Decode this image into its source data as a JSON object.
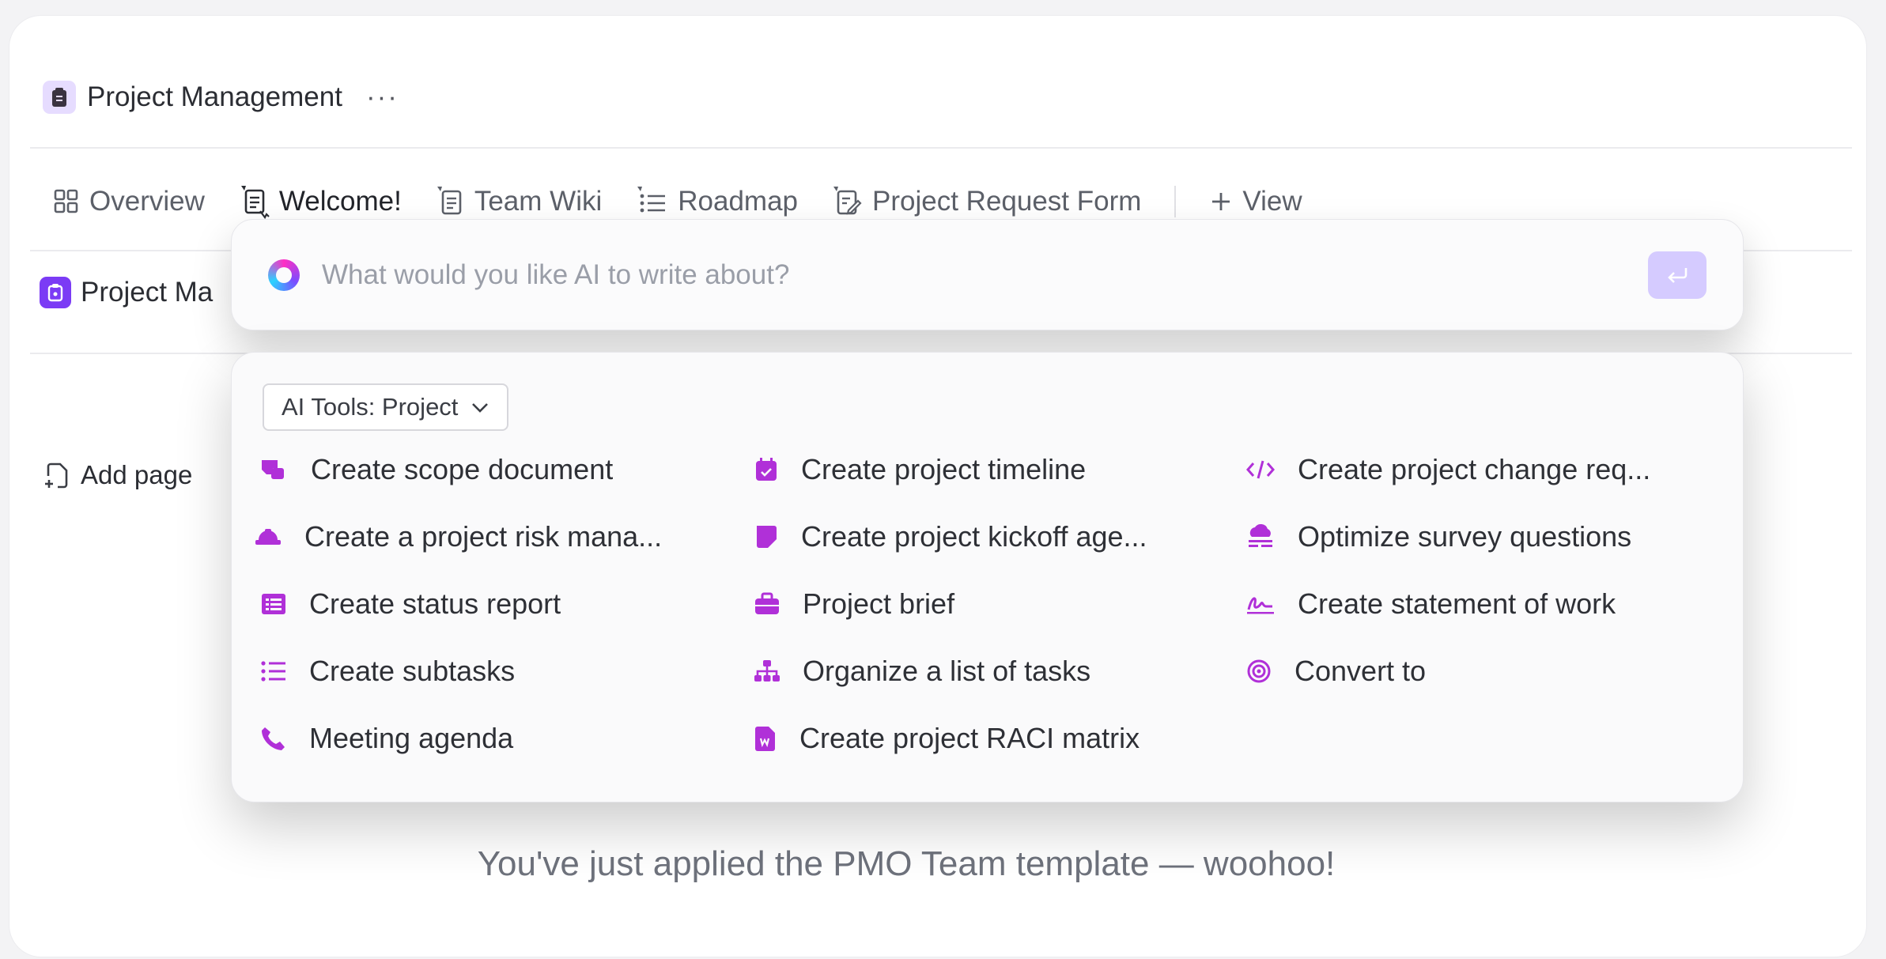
{
  "header": {
    "title": "Project Management",
    "more": "···"
  },
  "tabs": [
    {
      "label": "Overview"
    },
    {
      "label": "Welcome!"
    },
    {
      "label": "Team Wiki"
    },
    {
      "label": "Roadmap"
    },
    {
      "label": "Project Request Form"
    },
    {
      "label": "View"
    }
  ],
  "subheader": {
    "title": "Project Ma"
  },
  "sidebar": {
    "add_page": "Add page"
  },
  "content": {
    "welcome_text": "You've just applied the PMO Team template — woohoo!"
  },
  "ai": {
    "placeholder": "What would you like AI to write about?",
    "tools_label": "AI Tools: Project",
    "accent": "#b030d8",
    "items": [
      {
        "label": "Create scope document",
        "icon": "document-stamp-icon"
      },
      {
        "label": "Create project timeline",
        "icon": "calendar-icon"
      },
      {
        "label": "Create project change req...",
        "icon": "code-icon"
      },
      {
        "label": "Create a project risk mana...",
        "icon": "hardhat-icon"
      },
      {
        "label": "Create project kickoff age...",
        "icon": "note-icon"
      },
      {
        "label": "Optimize survey questions",
        "icon": "cloud-list-icon"
      },
      {
        "label": "Create status report",
        "icon": "list-box-icon"
      },
      {
        "label": "Project brief",
        "icon": "briefcase-icon"
      },
      {
        "label": "Create statement of work",
        "icon": "signature-icon"
      },
      {
        "label": "Create subtasks",
        "icon": "bullet-list-icon"
      },
      {
        "label": "Organize a list of tasks",
        "icon": "hierarchy-icon"
      },
      {
        "label": "Convert to",
        "icon": "target-icon"
      },
      {
        "label": "Meeting agenda",
        "icon": "phone-icon"
      },
      {
        "label": "Create project RACI matrix",
        "icon": "word-doc-icon"
      }
    ]
  }
}
